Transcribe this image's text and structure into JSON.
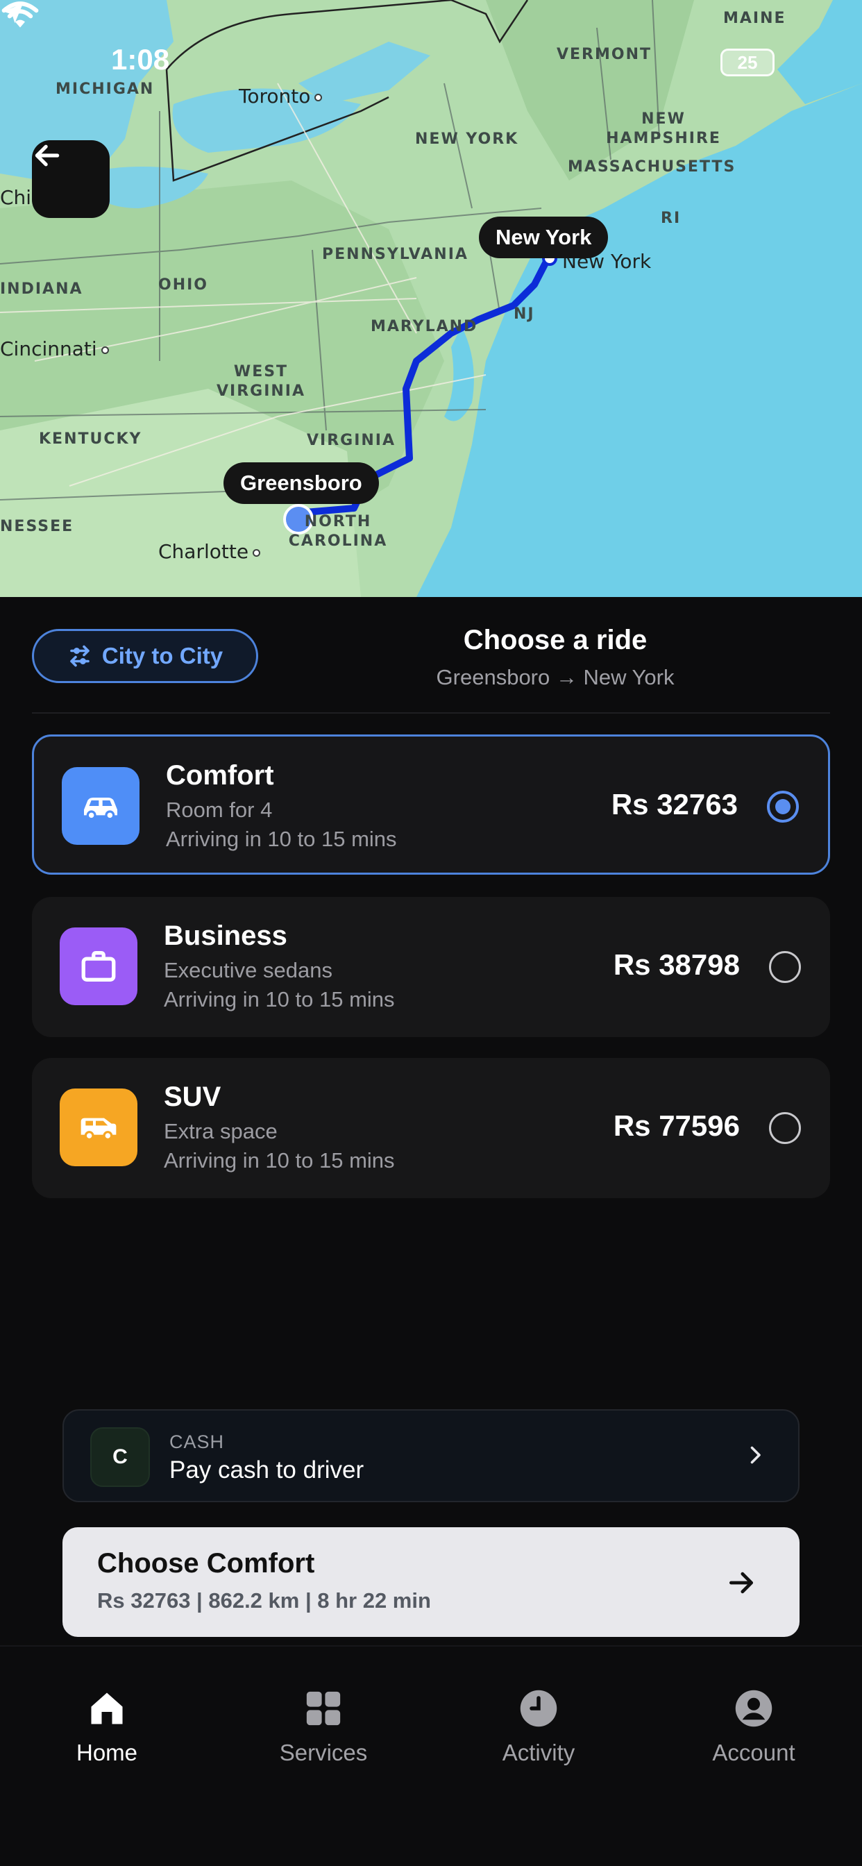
{
  "status_bar": {
    "time": "1:08",
    "battery": "25"
  },
  "map": {
    "states": [
      "MAINE",
      "VERMONT",
      "NEW HAMPSHIRE",
      "NEW YORK",
      "MASSACHUSETTS",
      "RI",
      "PENNSYLVANIA",
      "NJ",
      "MARYLAND",
      "OHIO",
      "INDIANA",
      "WEST VIRGINIA",
      "KENTUCKY",
      "VIRGINIA",
      "NORTH CAROLINA",
      "MICHIGAN",
      "NESSEE"
    ],
    "cities": {
      "toronto": "Toronto",
      "new_york": "New York",
      "cincinnati": "Cincinnati",
      "charlotte": "Charlotte",
      "chi": "Chi"
    },
    "origin_pin": "Greensboro",
    "destination_pin": "New York"
  },
  "header": {
    "mode_chip": "City to City",
    "title": "Choose a ride",
    "route": "Greensboro → New York"
  },
  "rides": [
    {
      "name": "Comfort",
      "desc": "Room for 4",
      "eta": "Arriving in 10 to 15 mins",
      "price": "Rs 32763",
      "icon": "car-icon",
      "color": "#4f8ef7",
      "selected": true
    },
    {
      "name": "Business",
      "desc": "Executive sedans",
      "eta": "Arriving in 10 to 15 mins",
      "price": "Rs 38798",
      "icon": "briefcase-icon",
      "color": "#9b5cf6",
      "selected": false
    },
    {
      "name": "SUV",
      "desc": "Extra space",
      "eta": "Arriving in 10 to 15 mins",
      "price": "Rs 77596",
      "icon": "suv-icon",
      "color": "#f6a623",
      "selected": false
    }
  ],
  "payment": {
    "badge": "C",
    "type": "CASH",
    "label": "Pay cash to driver"
  },
  "cta": {
    "title": "Choose Comfort",
    "subtitle": "Rs 32763 | 862.2 km | 8 hr 22 min"
  },
  "tabs": [
    {
      "label": "Home",
      "icon": "home-icon",
      "active": true
    },
    {
      "label": "Services",
      "icon": "grid-icon",
      "active": false
    },
    {
      "label": "Activity",
      "icon": "clock-icon",
      "active": false
    },
    {
      "label": "Account",
      "icon": "person-icon",
      "active": false
    }
  ]
}
